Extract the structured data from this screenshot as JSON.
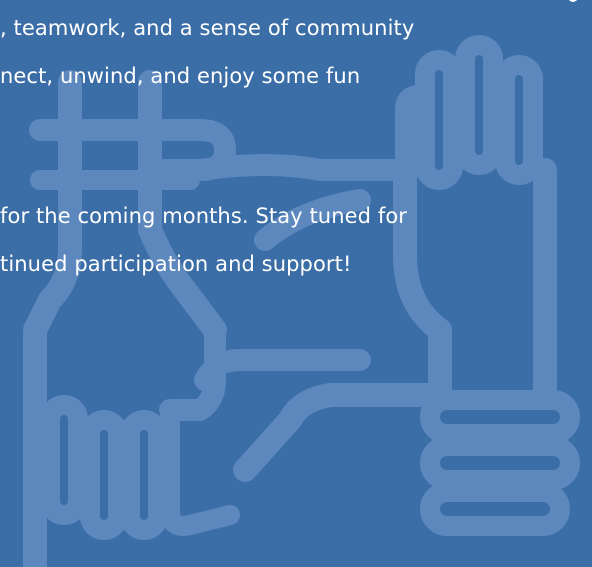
{
  "paragraph1": {
    "line1": ", teamwork, and a sense of community",
    "line2": "nect, unwind, and enjoy some fun"
  },
  "paragraph2": {
    "line1": "for the coming months.  Stay tuned for",
    "line2": "tinued participation and support!"
  },
  "decoration": {
    "icon": "joined-hands-icon",
    "background_color": "#3b6ea6",
    "icon_color": "#5d88bd"
  }
}
